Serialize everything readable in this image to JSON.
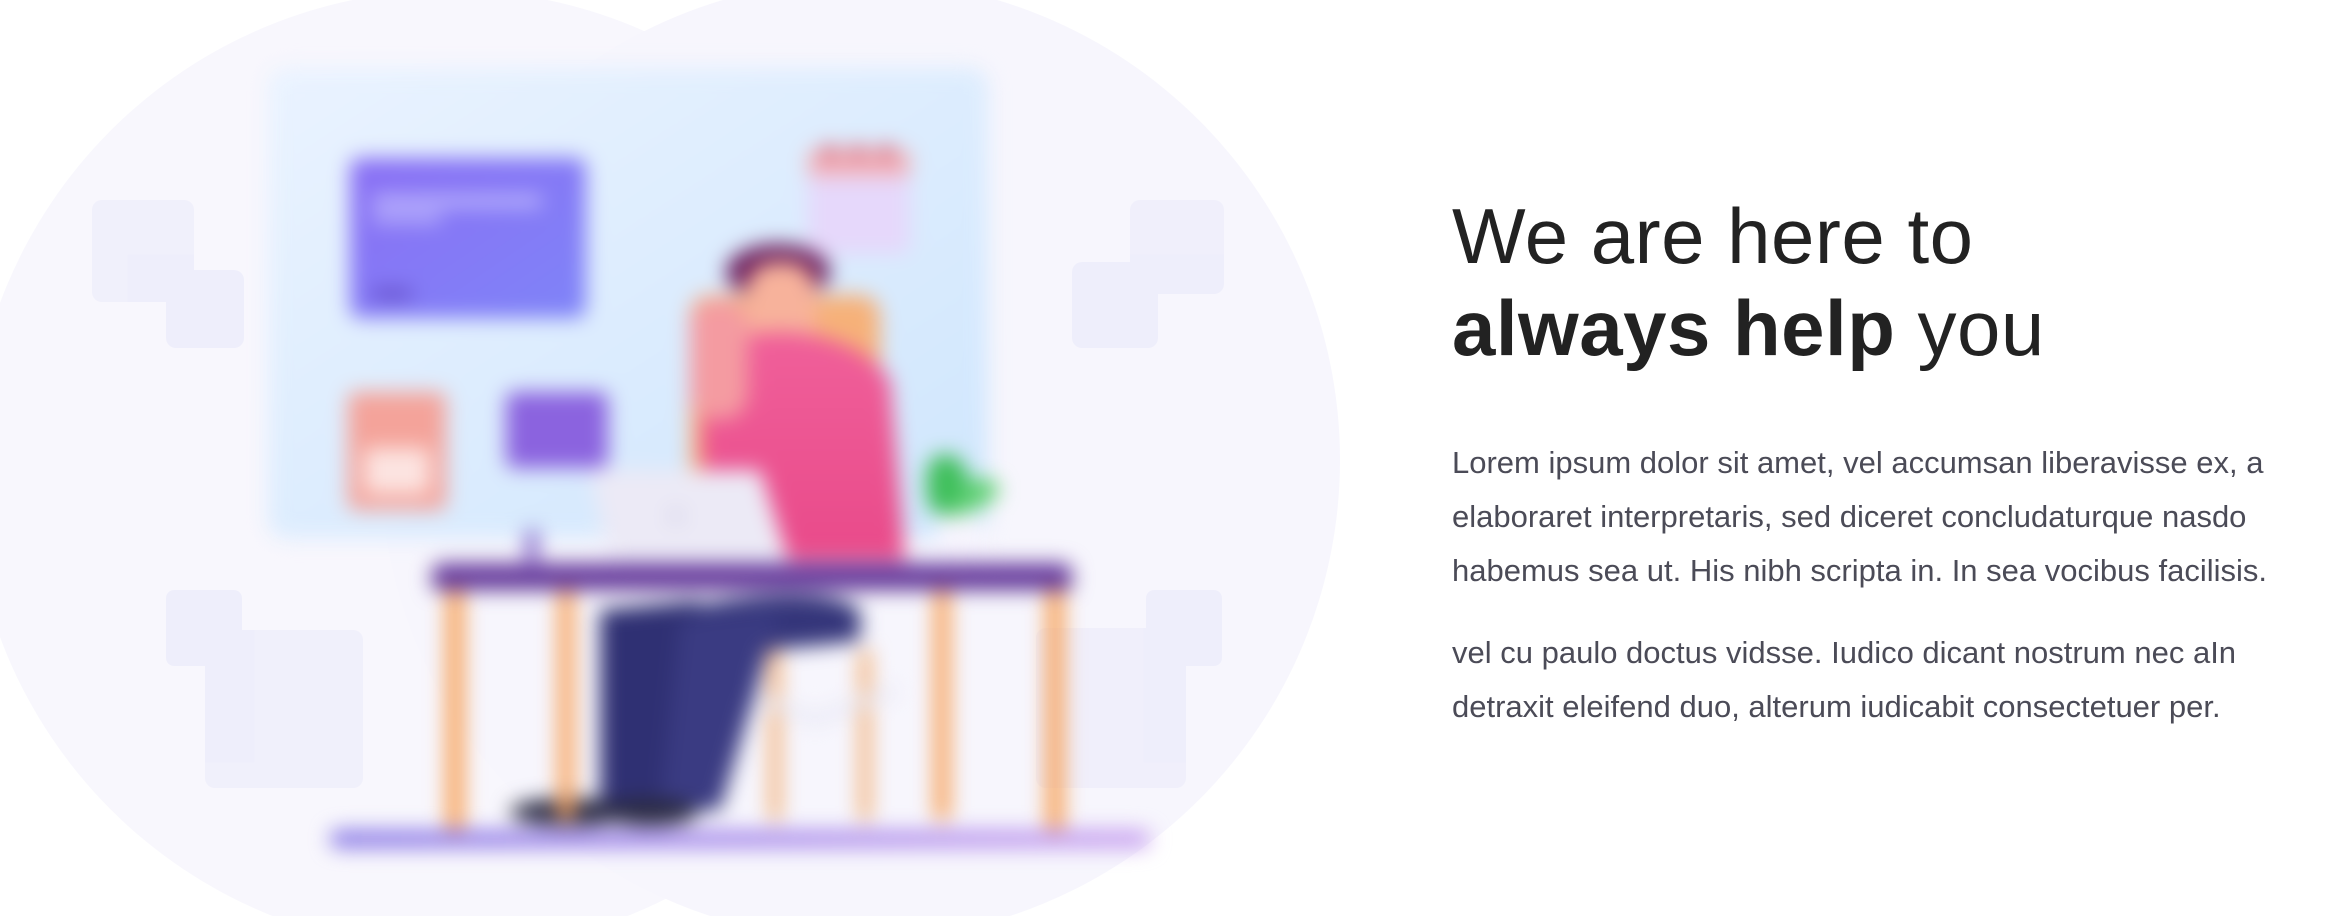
{
  "illustration": {
    "alt": "Person working at a desk with a laptop",
    "colors": {
      "circle": "#f7f6fc",
      "board": "#dceefe",
      "card_purple": "#8272f5",
      "shirt": "#ee5a8f",
      "pants": "#333478",
      "desk_top": "#6b3fa0",
      "desk_legs": "#f7a35d",
      "floor": "#b08ee6",
      "plant": "#41c25f"
    }
  },
  "hero": {
    "headline_line1": "We are here to",
    "headline_bold": "always help",
    "headline_tail": " you",
    "paragraph1_lines": [
      "Lorem ipsum dolor sit amet, vel accumsan liberavisse ex, a",
      "elaboraret interpretaris, sed diceret concludaturque nasdo",
      "habemus sea ut. His nibh scripta in. In sea vocibus facilisis."
    ],
    "paragraph2_lines": [
      "vel cu paulo doctus vidsse. Iudico dicant nostrum nec aIn",
      "detraxit eleifend duo, alterum iudicabit consectetuer per."
    ]
  }
}
